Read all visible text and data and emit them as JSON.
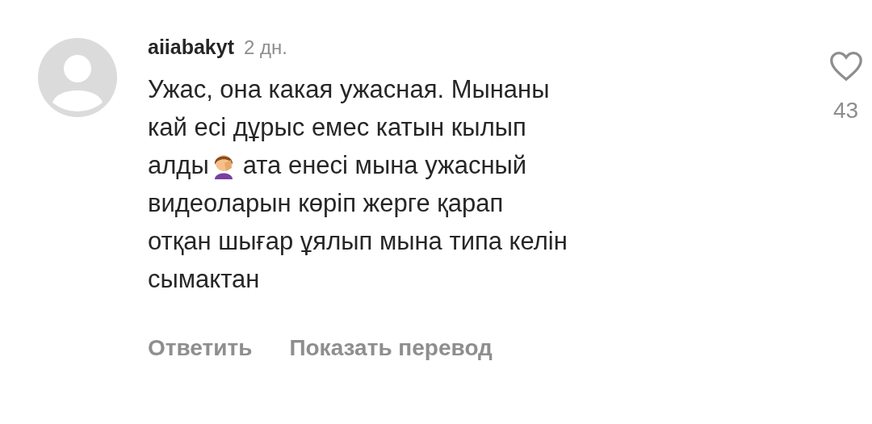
{
  "comment": {
    "username": "aiiabakyt",
    "time": "2 дн.",
    "lines": [
      {
        "kind": "text",
        "text": "Ужас, она какая ужасная. Мынаны"
      },
      {
        "kind": "text",
        "text": "кай есі дұрыс емес катын кылып"
      },
      {
        "kind": "emoji",
        "before": "алды",
        "after": "ата енесі мына ужасный"
      },
      {
        "kind": "text",
        "text": "видеоларын көріп жерге қарап"
      },
      {
        "kind": "text",
        "text": "отқан шығар ұялып мына типа келін"
      },
      {
        "kind": "text",
        "text": "сымактан"
      }
    ],
    "liked": false,
    "like_count": "43",
    "actions": [
      "Ответить",
      "Показать перевод"
    ]
  }
}
